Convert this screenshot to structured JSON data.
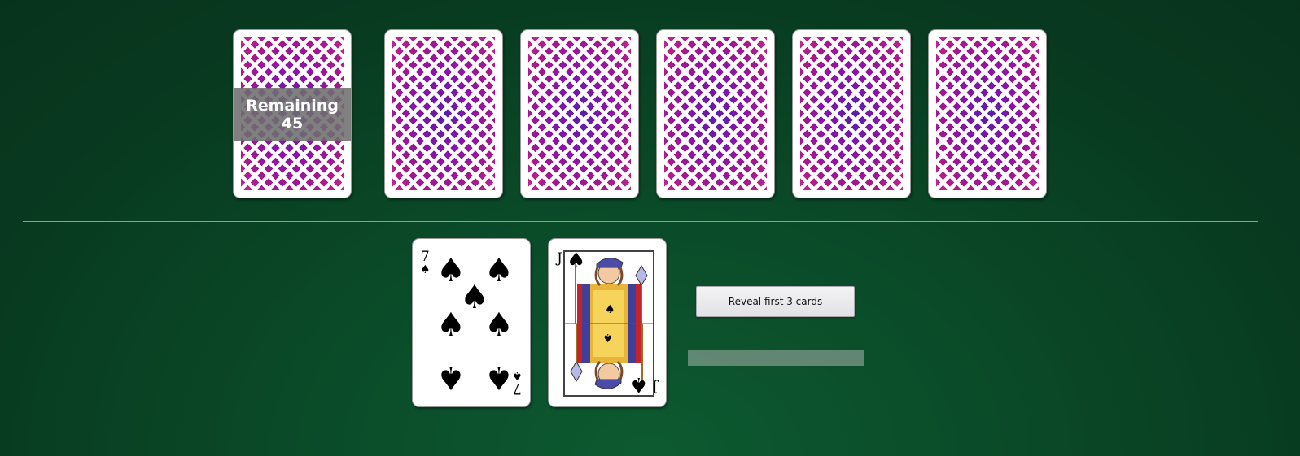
{
  "deck": {
    "remaining_label": "Remaining",
    "remaining_count": "45"
  },
  "back_cards": [
    {
      "id": "back-card-1"
    },
    {
      "id": "back-card-2"
    },
    {
      "id": "back-card-3"
    },
    {
      "id": "back-card-4"
    },
    {
      "id": "back-card-5"
    }
  ],
  "player_cards": [
    {
      "rank": "7",
      "suit": "♠",
      "name": "seven-of-spades"
    },
    {
      "rank": "J",
      "suit": "♠",
      "name": "jack-of-spades"
    }
  ],
  "controls": {
    "reveal_label": "Reveal first 3 cards",
    "status_text": ""
  },
  "colors": {
    "table": "#0a4a28",
    "card_back": "#8a16a6",
    "button": "#e6e6ea"
  }
}
